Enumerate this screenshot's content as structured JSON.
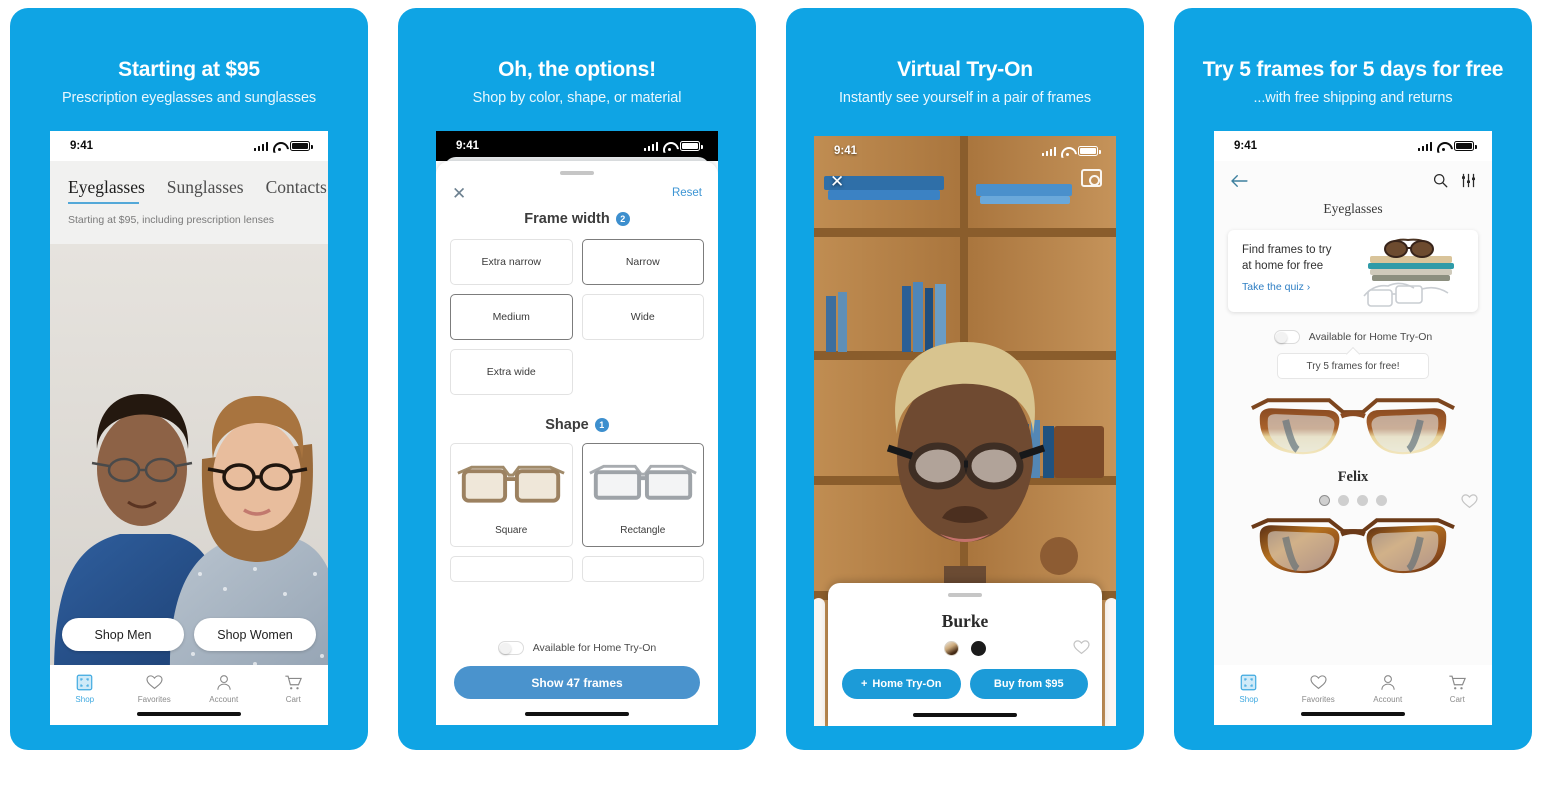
{
  "brand": {
    "accent": "#0fa4e4",
    "link": "#3d95d4",
    "cta": "#4a93cd"
  },
  "panels": [
    {
      "title": "Starting at $95",
      "subtitle": "Prescription eyeglasses and sunglasses",
      "status": {
        "time": "9:41"
      },
      "tabs": [
        {
          "label": "Eyeglasses",
          "active": true
        },
        {
          "label": "Sunglasses",
          "active": false
        },
        {
          "label": "Contacts",
          "active": false
        }
      ],
      "note": "Starting at $95, including prescription lenses",
      "buttons": [
        {
          "label": "Shop Men"
        },
        {
          "label": "Shop Women"
        }
      ],
      "tabbar": [
        {
          "label": "Shop",
          "icon": "shop-icon",
          "active": true
        },
        {
          "label": "Favorites",
          "icon": "heart-icon",
          "active": false
        },
        {
          "label": "Account",
          "icon": "person-icon",
          "active": false
        },
        {
          "label": "Cart",
          "icon": "cart-icon",
          "active": false
        }
      ]
    },
    {
      "title": "Oh, the options!",
      "subtitle": "Shop by color, shape, or material",
      "status": {
        "time": "9:41"
      },
      "close_label": "✕",
      "reset_label": "Reset",
      "section_width": {
        "label": "Frame width",
        "count": "2"
      },
      "width_options": [
        {
          "label": "Extra narrow",
          "selected": false
        },
        {
          "label": "Narrow",
          "selected": true
        },
        {
          "label": "Medium",
          "selected": true
        },
        {
          "label": "Wide",
          "selected": false
        },
        {
          "label": "Extra wide",
          "selected": false
        }
      ],
      "section_shape": {
        "label": "Shape",
        "count": "1"
      },
      "shape_options": [
        {
          "label": "Square",
          "selected": false
        },
        {
          "label": "Rectangle",
          "selected": true
        }
      ],
      "toggle_label": "Available for Home Try-On",
      "cta_label": "Show 47 frames"
    },
    {
      "title": "Virtual Try-On",
      "subtitle": "Instantly see yourself in a pair of frames",
      "status": {
        "time": "9:41"
      },
      "close_label": "✕",
      "camera_icon": "camera-icon",
      "product_name": "Burke",
      "swatches": [
        {
          "name": "tortoise"
        },
        {
          "name": "black"
        }
      ],
      "favorite_icon": "heart-outline-icon",
      "buttons": [
        {
          "label": "Home Try-On",
          "prefix": "+"
        },
        {
          "label": "Buy from $95",
          "prefix": ""
        }
      ]
    },
    {
      "title": "Try 5 frames for 5 days for free",
      "subtitle": "...with free shipping and returns",
      "status": {
        "time": "9:41"
      },
      "back_icon": "back-arrow-icon",
      "search_icon": "search-icon",
      "filter_icon": "filter-icon",
      "page_title": "Eyeglasses",
      "quiz_card": {
        "line1": "Find frames to try",
        "line2": "at home for free",
        "link": "Take the quiz",
        "chevron": "›"
      },
      "toggle_label": "Available for Home Try-On",
      "tip_label": "Try 5 frames for free!",
      "product_name": "Felix",
      "dots": [
        {
          "on": true
        },
        {
          "on": false
        },
        {
          "on": false
        },
        {
          "on": false
        }
      ],
      "favorite_icon": "heart-outline-icon",
      "tabbar": [
        {
          "label": "Shop",
          "icon": "shop-icon",
          "active": true
        },
        {
          "label": "Favorites",
          "icon": "heart-icon",
          "active": false
        },
        {
          "label": "Account",
          "icon": "person-icon",
          "active": false
        },
        {
          "label": "Cart",
          "icon": "cart-icon",
          "active": false
        }
      ]
    }
  ]
}
